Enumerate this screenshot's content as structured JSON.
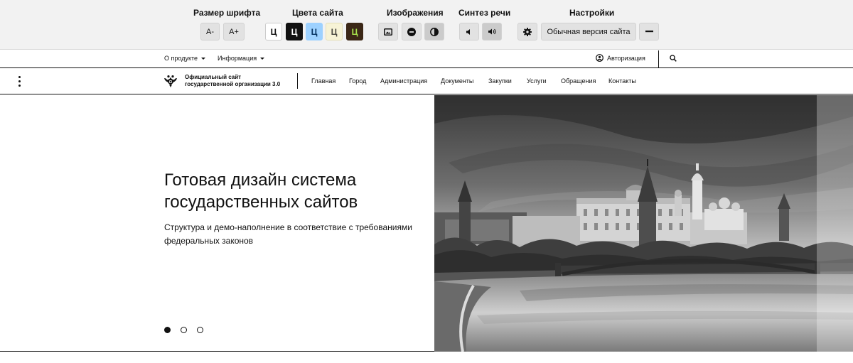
{
  "accessibility": {
    "font_size": {
      "title": "Размер шрифта",
      "decrease": "A-",
      "increase": "A+"
    },
    "colors": {
      "title": "Цвета сайта",
      "schemes": [
        {
          "letter": "Ц",
          "bg": "#ffffff",
          "fg": "#111111",
          "border": "#cccccc"
        },
        {
          "letter": "Ц",
          "bg": "#111111",
          "fg": "#ffffff",
          "border": "#111111"
        },
        {
          "letter": "Ц",
          "bg": "#9dd1ff",
          "fg": "#063462",
          "border": "#9dd1ff"
        },
        {
          "letter": "Ц",
          "bg": "#f7f3d6",
          "fg": "#4d4b43",
          "border": "#e5dfb8"
        },
        {
          "letter": "Ц",
          "bg": "#3b2716",
          "fg": "#a9e44d",
          "border": "#3b2716"
        }
      ]
    },
    "images": {
      "title": "Изображения",
      "buttons": [
        "image-icon",
        "minus-circle-icon",
        "contrast-icon"
      ]
    },
    "speech": {
      "title": "Синтез речи",
      "buttons": [
        "speaker-off-icon",
        "speaker-on-icon"
      ]
    },
    "settings": {
      "title": "Настройки",
      "regular_version": "Обычная версия сайта",
      "gear": "gear-icon",
      "collapse": "minus-icon"
    }
  },
  "utility_bar": {
    "about": "О продукте",
    "info": "Информация",
    "login": "Авторизация",
    "login_icon": "user-circle-icon",
    "search_icon": "search-icon"
  },
  "header": {
    "site_name_line1": "Официальный сайт",
    "site_name_line2": "государственной организации 3.0",
    "nav": [
      "Главная",
      "Город",
      "Администрация",
      "Документы",
      "Закупки",
      "Услуги",
      "Обращения",
      "Контакты"
    ]
  },
  "hero": {
    "title_line1": "Готовая дизайн система",
    "title_line2": "государственных сайтов",
    "subtitle_line1": "Структура и демо-наполнение в соответствие с требованиями",
    "subtitle_line2": "федеральных законов",
    "slides": 3,
    "active_slide": 1
  },
  "colors": {
    "text": "#111111",
    "panel_bg": "#f2f2f2",
    "button_bg": "#e2e2e2"
  }
}
